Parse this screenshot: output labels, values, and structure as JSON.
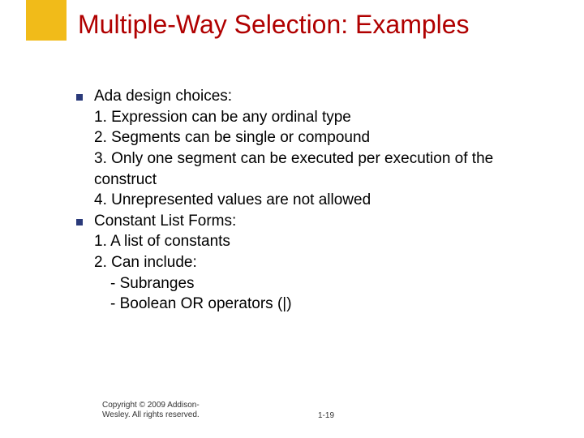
{
  "title": "Multiple-Way Selection: Examples",
  "s1": {
    "head": "Ada design choices:",
    "l1": "1. Expression can be any ordinal type",
    "l2": "2. Segments can be single or compound",
    "l3": "3. Only one segment can be executed per execution of the construct",
    "l4": "4. Unrepresented values are not allowed"
  },
  "s2": {
    "head": "Constant List Forms:",
    "l1": "1. A list of constants",
    "l2": "2. Can include:",
    "sub1": "- Subranges",
    "sub2": "- Boolean OR operators (|)"
  },
  "footer": {
    "l1": "Copyright © 2009 Addison-",
    "l2": "Wesley. All rights reserved."
  },
  "pagenum": "1-19"
}
